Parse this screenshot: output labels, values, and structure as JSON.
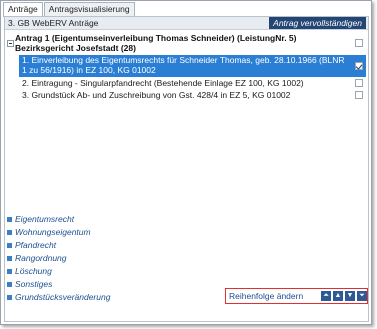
{
  "tabs": [
    {
      "label": "Anträge"
    },
    {
      "label": "Antragsvisualisierung"
    }
  ],
  "header": {
    "title": "3. GB WebERV Anträge",
    "complete_button": "Antrag vervollständigen"
  },
  "group": {
    "title": "Antrag 1 (Eigentumseinverleibung Thomas Schneider) (LeistungNr. 5) Bezirksgericht Josefstadt (28)"
  },
  "items": [
    {
      "text": "1. Einverleibung des Eigentumsrechts für Schneider Thomas, geb. 28.10.1966 (BLNR 1 zu 56/1916) in EZ 100, KG 01002",
      "selected": true,
      "checked": true
    },
    {
      "text": "2. Eintragung - Singularpfandrecht (Bestehende Einlage EZ 100, KG 1002)",
      "selected": false,
      "checked": false
    },
    {
      "text": "3. Grundstück Ab- und Zuschreibung von Gst. 428/4 in EZ 5, KG 01002",
      "selected": false,
      "checked": false
    }
  ],
  "categories": [
    {
      "label": "Eigentumsrecht"
    },
    {
      "label": "Wohnungseigentum"
    },
    {
      "label": "Pfandrecht"
    },
    {
      "label": "Rangordnung"
    },
    {
      "label": "Löschung"
    },
    {
      "label": "Sonstiges"
    },
    {
      "label": "Grundstücksveränderung"
    }
  ],
  "reorder": {
    "label": "Reihenfolge ändern",
    "buttons": [
      "arrow-top-icon",
      "arrow-up-icon",
      "arrow-down-icon",
      "arrow-bottom-icon"
    ]
  },
  "colors": {
    "accent": "#234675",
    "selection": "#2a7fd4",
    "link": "#1d4f91",
    "highlight_border": "#e03131"
  }
}
